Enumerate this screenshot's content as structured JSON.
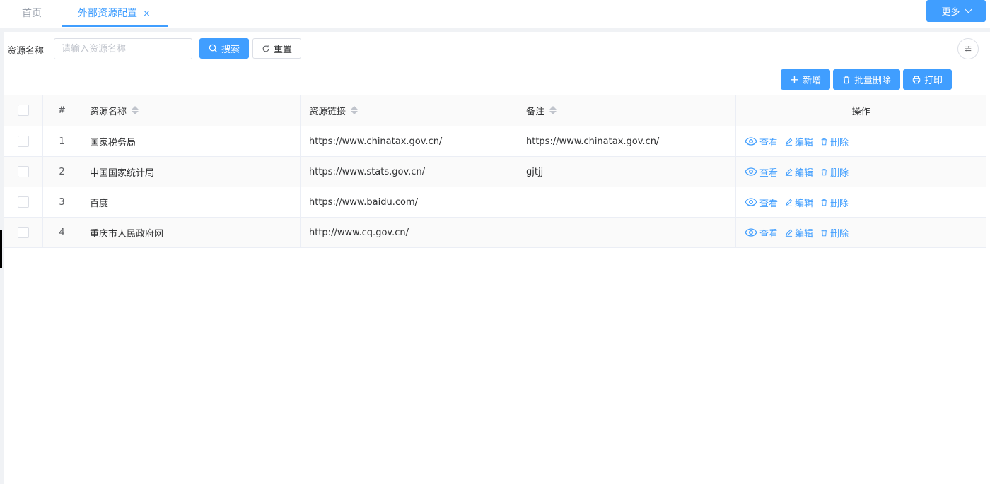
{
  "tabs": [
    {
      "label": "首页"
    },
    {
      "label": "外部资源配置",
      "close": "×"
    }
  ],
  "more_label": "更多",
  "search": {
    "label": "资源名称",
    "placeholder": "请输入资源名称",
    "value": "",
    "search_label": "搜索",
    "reset_label": "重置"
  },
  "actions": {
    "add_label": "新增",
    "batch_delete_label": "批量删除",
    "print_label": "打印"
  },
  "table": {
    "headers": {
      "index": "#",
      "name": "资源名称",
      "url": "资源链接",
      "note": "备注",
      "ops": "操作"
    },
    "rows": [
      {
        "index": "1",
        "name": "国家税务局",
        "url": "https://www.chinatax.gov.cn/",
        "note": "https://www.chinatax.gov.cn/"
      },
      {
        "index": "2",
        "name": "中国国家统计局",
        "url": "https://www.stats.gov.cn/",
        "note": "gjtjj"
      },
      {
        "index": "3",
        "name": "百度",
        "url": "https://www.baidu.com/",
        "note": ""
      },
      {
        "index": "4",
        "name": "重庆市人民政府网",
        "url": "http://www.cq.gov.cn/",
        "note": ""
      }
    ],
    "op_labels": {
      "view": "查看",
      "edit": "编辑",
      "delete": "删除"
    }
  },
  "colors": {
    "accent": "#409eff",
    "border": "#ebeef5"
  }
}
